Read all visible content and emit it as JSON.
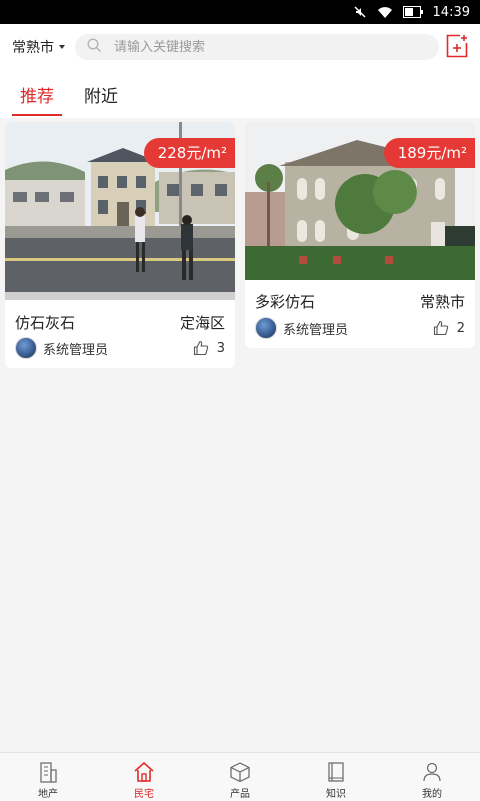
{
  "status_bar": {
    "time": "14:39"
  },
  "header": {
    "city": "常熟市",
    "search_placeholder": "请输入关键搜索"
  },
  "tabs": [
    {
      "label": "推荐"
    },
    {
      "label": "附近"
    }
  ],
  "cards": [
    {
      "price": "228元/m²",
      "title": "仿石灰石",
      "district": "定海区",
      "author": "系统管理员",
      "likes": "3"
    },
    {
      "price": "189元/m²",
      "title": "多彩仿石",
      "district": "常熟市",
      "author": "系统管理员",
      "likes": "2"
    }
  ],
  "bottom_nav": [
    {
      "label": "地产",
      "icon": "building-icon"
    },
    {
      "label": "民宅",
      "icon": "home-icon"
    },
    {
      "label": "产品",
      "icon": "box-icon"
    },
    {
      "label": "知识",
      "icon": "book-icon"
    },
    {
      "label": "我的",
      "icon": "user-icon"
    }
  ],
  "colors": {
    "accent": "#e02b2b",
    "price_tag": "#e53935",
    "background": "#f4f4f4"
  }
}
